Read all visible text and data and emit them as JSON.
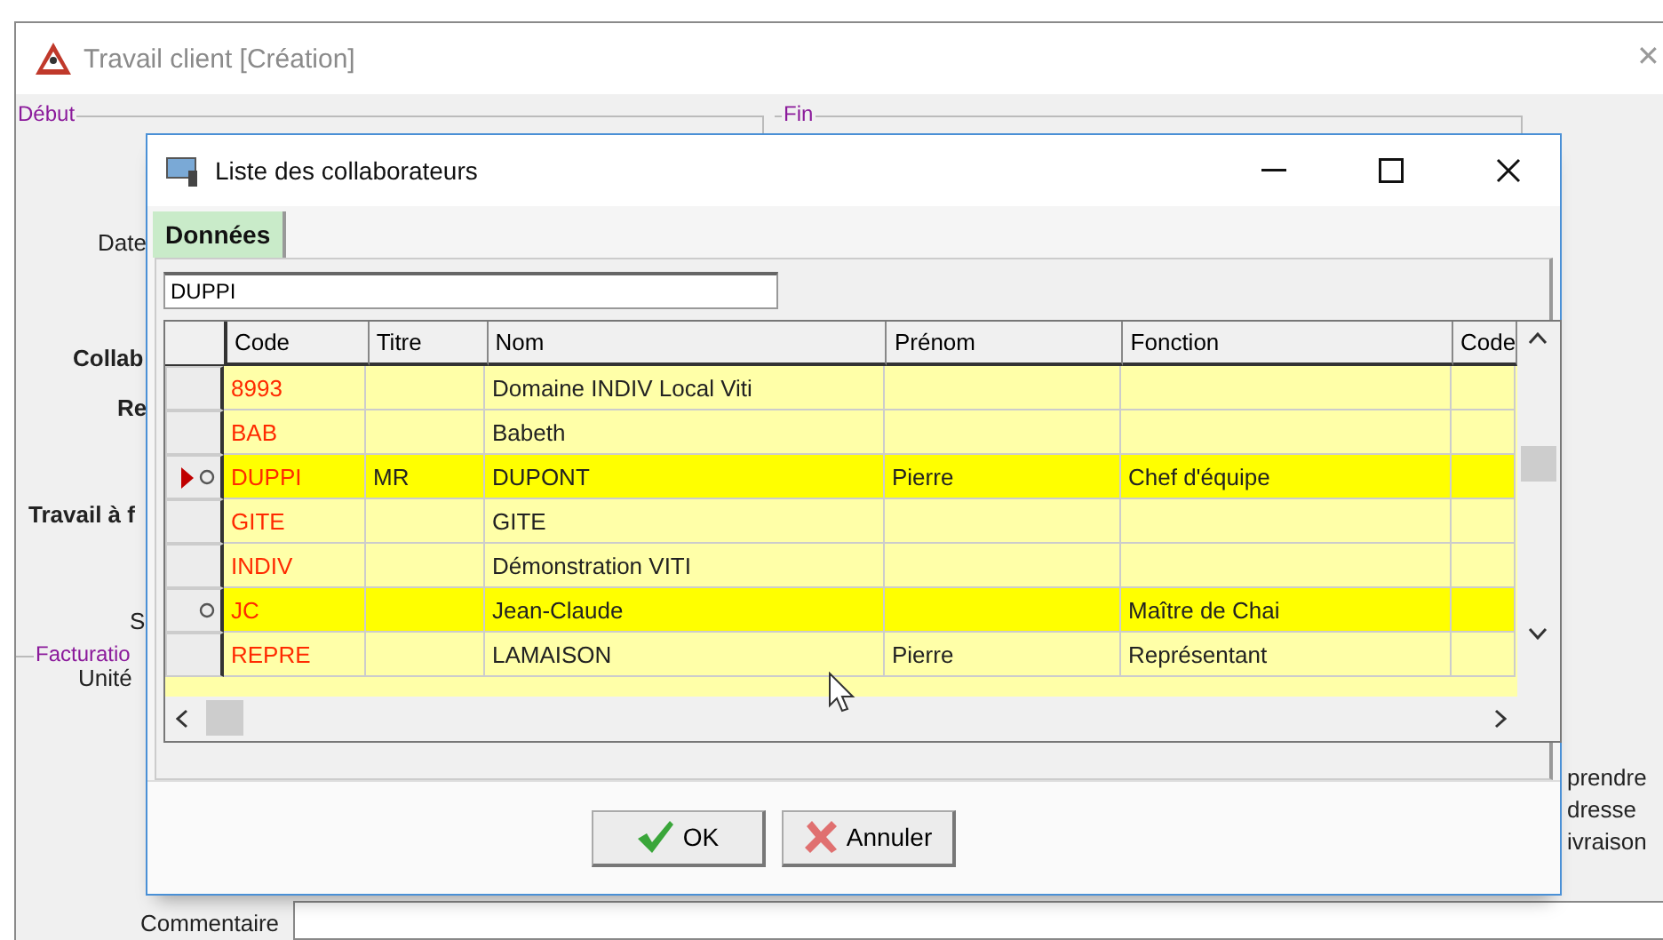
{
  "window": {
    "title": "Travail client [Création]",
    "groups": [
      {
        "label": "Début"
      },
      {
        "label": "Fin"
      },
      {
        "label": "Facturatio"
      }
    ],
    "labels": [
      {
        "text": "Date",
        "kind": "plain"
      },
      {
        "text": "Collab",
        "kind": "bold"
      },
      {
        "text": "Re",
        "kind": "bold"
      },
      {
        "text": "Travail à f",
        "kind": "bold"
      },
      {
        "text": "S",
        "kind": "plain"
      },
      {
        "text": "Unité",
        "kind": "plain"
      }
    ],
    "close_glyph": "✕",
    "right_texts": [
      "prendre",
      "dresse",
      "ivraison"
    ],
    "comment_label": "Commentaire"
  },
  "dialog": {
    "title": "Liste des collaborateurs",
    "tabs": [
      {
        "label": "Données",
        "selected": true
      }
    ],
    "search": {
      "value": "DUPPI"
    },
    "table": {
      "columns": [
        "Code",
        "Titre",
        "Nom",
        "Prénom",
        "Fonction",
        "Code"
      ],
      "rows": [
        {
          "cells": [
            "8993",
            "",
            "Domaine INDIV Local Viti",
            "",
            "",
            ""
          ],
          "selected": false,
          "marked": false
        },
        {
          "cells": [
            "BAB",
            "",
            "Babeth",
            "",
            "",
            ""
          ],
          "selected": false,
          "marked": false
        },
        {
          "cells": [
            "DUPPI",
            "MR",
            "DUPONT",
            "Pierre",
            "Chef d'équipe",
            ""
          ],
          "selected": true,
          "marked": true
        },
        {
          "cells": [
            "GITE",
            "",
            "GITE",
            "",
            "",
            ""
          ],
          "selected": false,
          "marked": false
        },
        {
          "cells": [
            "INDIV",
            "",
            "Démonstration VITI",
            "",
            "",
            ""
          ],
          "selected": false,
          "marked": false
        },
        {
          "cells": [
            "JC",
            "",
            "Jean-Claude",
            "",
            "Maître de Chai",
            ""
          ],
          "selected": false,
          "marked": true
        },
        {
          "cells": [
            "REPRE",
            "",
            "LAMAISON",
            "Pierre",
            "Représentant",
            ""
          ],
          "selected": false,
          "marked": false
        }
      ]
    },
    "buttons": [
      {
        "label": "OK",
        "kind": "ok"
      },
      {
        "label": "Annuler",
        "kind": "cancel"
      }
    ]
  }
}
